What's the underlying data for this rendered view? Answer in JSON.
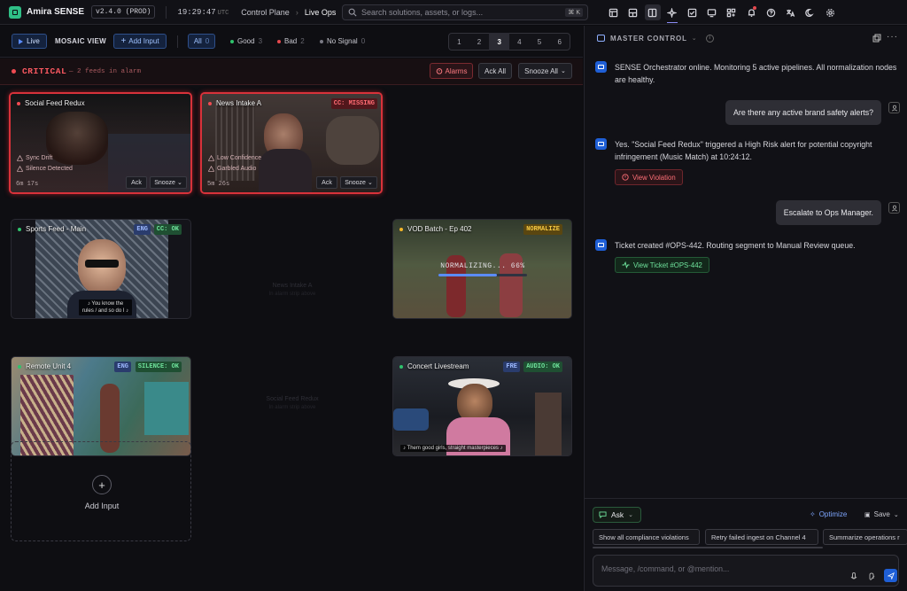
{
  "topbar": {
    "app_name": "Amira SENSE",
    "version": "v2.4.0 (PROD)",
    "clock": "19:29:47",
    "timezone": "UTC",
    "breadcrumb": [
      "Control Plane",
      "Live Ops"
    ],
    "search_placeholder": "Search solutions, assets, or logs...",
    "search_shortcut": "⌘ K",
    "icons": [
      "layout-icon",
      "dashboard-icon",
      "split-view-icon",
      "sparkle-icon",
      "checklist-icon",
      "monitor-icon",
      "grid-plus-icon",
      "bell-icon",
      "help-icon",
      "translate-icon",
      "theme-icon",
      "settings-icon"
    ],
    "active_icon": "split-view-icon",
    "underlined_icon": "sparkle-icon",
    "alert_icon": "bell-icon"
  },
  "filterbar": {
    "live_label": "Live",
    "mosaic_label": "MOSAIC VIEW",
    "add_input_label": "Add Input",
    "filters": [
      {
        "label": "All",
        "count": "0",
        "color": ""
      },
      {
        "label": "Good",
        "count": "3",
        "color": "#2fc26c"
      },
      {
        "label": "Bad",
        "count": "2",
        "color": "#e5484d"
      },
      {
        "label": "No Signal",
        "count": "0",
        "color": "#7a7a84"
      }
    ],
    "pages": [
      "1",
      "2",
      "3",
      "4",
      "5",
      "6"
    ],
    "active_page": "3"
  },
  "critical": {
    "title": "CRITICAL",
    "subtitle": "— 2 feeds in alarm",
    "alarms_label": "Alarms",
    "ack_all_label": "Ack All",
    "snooze_all_label": "Snooze All"
  },
  "alarm_feeds": [
    {
      "name": "Social Feed Redux",
      "issues": [
        "Sync Drift",
        "Silence Detected"
      ],
      "timer": "6m 17s",
      "ack": "Ack",
      "snooze": "Snooze",
      "badge": ""
    },
    {
      "name": "News Intake A",
      "issues": [
        "Low Confidence",
        "Garbled Audio"
      ],
      "timer": "5m 26s",
      "ack": "Ack",
      "snooze": "Snooze",
      "badge": "CC: MISSING"
    }
  ],
  "feeds": [
    {
      "name": "Sports Feed - Main",
      "status_color": "#2fc26c",
      "badges": [
        {
          "text": "ENG",
          "style": "blue"
        },
        {
          "text": "CC: OK",
          "style": "green"
        }
      ],
      "caption": "♪ You know the rules / and so do I ♪"
    },
    {
      "name": "VOD Batch - Ep 402",
      "status_color": "#f5b728",
      "badges": [
        {
          "text": "NORMALIZE",
          "style": "yellow"
        }
      ],
      "progress_label": "NORMALIZING... 66%",
      "progress": 0.66
    },
    {
      "name": "Remote Unit 4",
      "status_color": "#2fc26c",
      "badges": [
        {
          "text": "ENG",
          "style": "blue"
        },
        {
          "text": "SILENCE: OK",
          "style": "green"
        }
      ]
    },
    {
      "name": "Concert Livestream",
      "status_color": "#2fc26c",
      "badges": [
        {
          "text": "FRE",
          "style": "blue"
        },
        {
          "text": "AUDIO: OK",
          "style": "green"
        }
      ],
      "caption": "♪ Them good girls, straight masterpieces ♪"
    }
  ],
  "ghost_tiles": [
    {
      "name": "News Intake A",
      "note": "In alarm strip above"
    },
    {
      "name": "Social Feed Redux",
      "note": "In alarm strip above"
    }
  ],
  "add_input_tile": {
    "icon": "+",
    "label": "Add Input"
  },
  "master_control": {
    "title": "MASTER CONTROL",
    "info_icon": "i",
    "messages": [
      {
        "role": "bot",
        "text": "SENSE Orchestrator online. Monitoring 5 active pipelines. All normalization nodes are healthy."
      },
      {
        "role": "user",
        "text": "Are there any active brand safety alerts?"
      },
      {
        "role": "bot",
        "text": "Yes. \"Social Feed Redux\" triggered a High Risk alert for potential copyright infringement (Music Match) at 10:24:12.",
        "action": "View Violation",
        "action_style": "red"
      },
      {
        "role": "user",
        "text": "Escalate to Ops Manager."
      },
      {
        "role": "bot",
        "text": "Ticket created #OPS-442. Routing segment to Manual Review queue.",
        "action": "View Ticket #OPS-442",
        "action_style": "green"
      }
    ],
    "mode_label": "Ask",
    "optimize_label": "Optimize",
    "save_label": "Save",
    "suggestions": [
      "Show all compliance violations",
      "Retry failed ingest on Channel 4",
      "Summarize operations r"
    ],
    "input_placeholder": "Message, /command, or @mention..."
  },
  "colors": {
    "accent": "#5b8cff",
    "critical": "#f04b52",
    "good": "#2fc26c",
    "warn": "#f5b728",
    "brand": "#2fbf86"
  }
}
